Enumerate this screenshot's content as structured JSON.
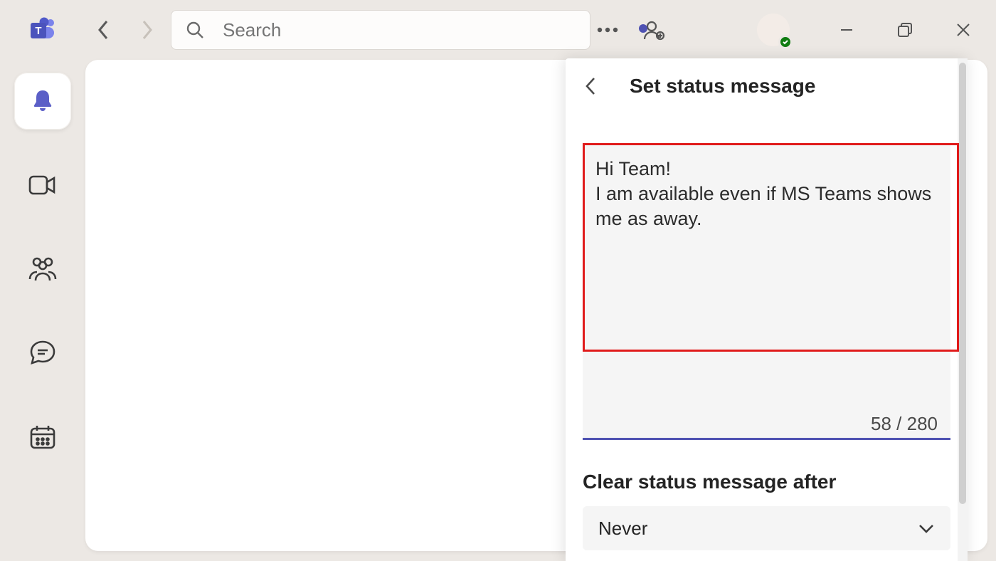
{
  "search": {
    "placeholder": "Search"
  },
  "rail": {
    "items": [
      {
        "name": "activity"
      },
      {
        "name": "video"
      },
      {
        "name": "community"
      },
      {
        "name": "chat"
      },
      {
        "name": "calendar"
      }
    ]
  },
  "status_panel": {
    "title": "Set status message",
    "message": "Hi Team!\nI am available even if MS Teams shows me as away.",
    "char_count": "58 / 280",
    "clear_label": "Clear status message after",
    "clear_value": "Never"
  }
}
